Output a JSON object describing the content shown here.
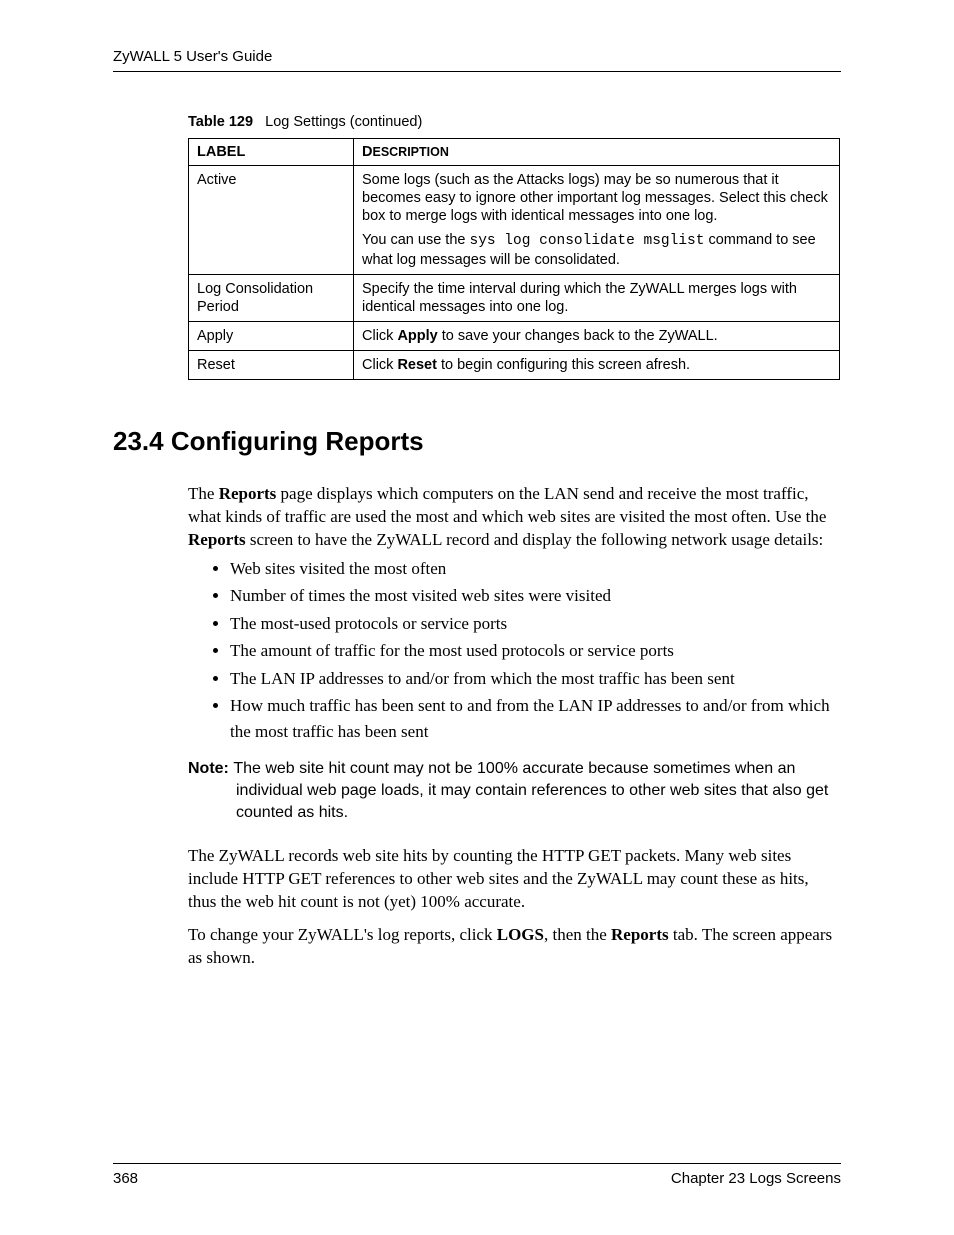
{
  "header": {
    "running": "ZyWALL 5 User's Guide"
  },
  "table": {
    "caption_num": "Table 129",
    "caption_text": "Log Settings (continued)",
    "col_label": "LABEL",
    "col_desc": "DESCRIPTION",
    "rows": {
      "active": {
        "label": "Active",
        "p1": "Some logs (such as the Attacks logs) may be so numerous that it becomes easy to ignore other important log messages. Select this check box to merge logs with identical messages into one log.",
        "p2_a": "You can use the ",
        "p2_cmd": "sys log consolidate msglist",
        "p2_b": " command to see what log messages will be consolidated."
      },
      "period": {
        "label": "Log Consolidation Period",
        "desc": "Specify the time interval during which the ZyWALL merges logs with identical messages into one log."
      },
      "apply": {
        "label": "Apply",
        "d1": "Click ",
        "d2": "Apply",
        "d3": " to save your changes back to the ZyWALL."
      },
      "reset": {
        "label": "Reset",
        "d1": "Click ",
        "d2": "Reset",
        "d3": " to begin configuring this screen afresh."
      }
    }
  },
  "section": {
    "heading": "23.4  Configuring Reports",
    "intro_a": "The ",
    "intro_b": "Reports",
    "intro_c": " page displays which computers on the LAN send and receive the most traffic, what kinds of traffic are used the most and which web sites are visited the most often. Use the ",
    "intro_d": "Reports",
    "intro_e": " screen to have the ZyWALL record and display the following network usage details:",
    "bullets": [
      "Web sites visited the most often",
      "Number of times the most visited web sites were visited",
      "The most-used protocols or service ports",
      "The amount of traffic for the most used protocols or service ports",
      "The LAN IP addresses to and/or from which the most traffic has been sent",
      "How much traffic has been sent to and from the LAN IP addresses to and/or from which the most traffic has been sent"
    ],
    "note_label": "Note: ",
    "note_body": "The web site hit count may not be 100% accurate because sometimes when an individual web page loads, it may contain references to other web sites that also get counted as hits.",
    "p_after1": "The ZyWALL records web site hits by counting the HTTP GET packets. Many web sites include HTTP GET references to other web sites and the ZyWALL may count these as hits, thus the web hit count is not (yet) 100% accurate.",
    "p_after2_a": "To change your ZyWALL's log reports, click ",
    "p_after2_b": "LOGS",
    "p_after2_c": ", then the ",
    "p_after2_d": "Reports",
    "p_after2_e": " tab. The screen appears as shown."
  },
  "footer": {
    "page": "368",
    "chapter": "Chapter 23 Logs Screens"
  }
}
